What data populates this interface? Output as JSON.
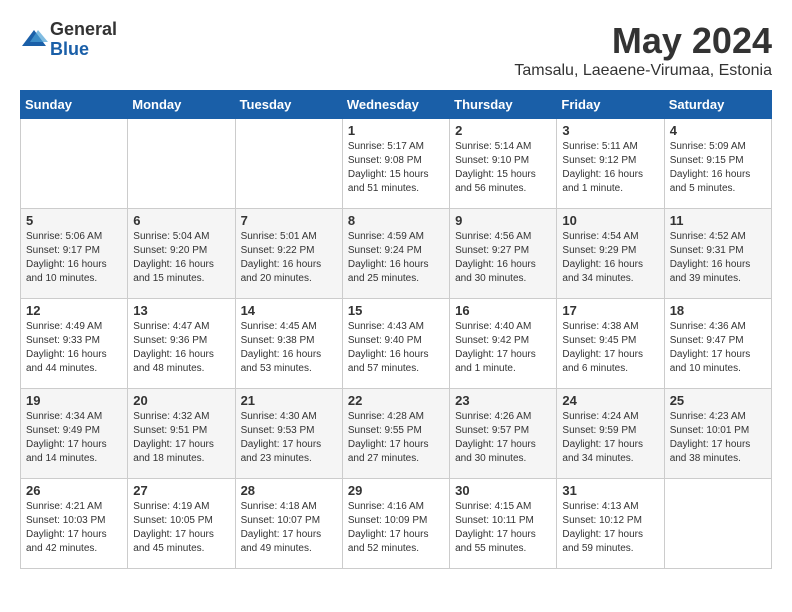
{
  "header": {
    "logo_general": "General",
    "logo_blue": "Blue",
    "month_year": "May 2024",
    "location": "Tamsalu, Laeaene-Virumaa, Estonia"
  },
  "weekdays": [
    "Sunday",
    "Monday",
    "Tuesday",
    "Wednesday",
    "Thursday",
    "Friday",
    "Saturday"
  ],
  "weeks": [
    [
      {
        "day": "",
        "info": ""
      },
      {
        "day": "",
        "info": ""
      },
      {
        "day": "",
        "info": ""
      },
      {
        "day": "1",
        "info": "Sunrise: 5:17 AM\nSunset: 9:08 PM\nDaylight: 15 hours and 51 minutes."
      },
      {
        "day": "2",
        "info": "Sunrise: 5:14 AM\nSunset: 9:10 PM\nDaylight: 15 hours and 56 minutes."
      },
      {
        "day": "3",
        "info": "Sunrise: 5:11 AM\nSunset: 9:12 PM\nDaylight: 16 hours and 1 minute."
      },
      {
        "day": "4",
        "info": "Sunrise: 5:09 AM\nSunset: 9:15 PM\nDaylight: 16 hours and 5 minutes."
      }
    ],
    [
      {
        "day": "5",
        "info": "Sunrise: 5:06 AM\nSunset: 9:17 PM\nDaylight: 16 hours and 10 minutes."
      },
      {
        "day": "6",
        "info": "Sunrise: 5:04 AM\nSunset: 9:20 PM\nDaylight: 16 hours and 15 minutes."
      },
      {
        "day": "7",
        "info": "Sunrise: 5:01 AM\nSunset: 9:22 PM\nDaylight: 16 hours and 20 minutes."
      },
      {
        "day": "8",
        "info": "Sunrise: 4:59 AM\nSunset: 9:24 PM\nDaylight: 16 hours and 25 minutes."
      },
      {
        "day": "9",
        "info": "Sunrise: 4:56 AM\nSunset: 9:27 PM\nDaylight: 16 hours and 30 minutes."
      },
      {
        "day": "10",
        "info": "Sunrise: 4:54 AM\nSunset: 9:29 PM\nDaylight: 16 hours and 34 minutes."
      },
      {
        "day": "11",
        "info": "Sunrise: 4:52 AM\nSunset: 9:31 PM\nDaylight: 16 hours and 39 minutes."
      }
    ],
    [
      {
        "day": "12",
        "info": "Sunrise: 4:49 AM\nSunset: 9:33 PM\nDaylight: 16 hours and 44 minutes."
      },
      {
        "day": "13",
        "info": "Sunrise: 4:47 AM\nSunset: 9:36 PM\nDaylight: 16 hours and 48 minutes."
      },
      {
        "day": "14",
        "info": "Sunrise: 4:45 AM\nSunset: 9:38 PM\nDaylight: 16 hours and 53 minutes."
      },
      {
        "day": "15",
        "info": "Sunrise: 4:43 AM\nSunset: 9:40 PM\nDaylight: 16 hours and 57 minutes."
      },
      {
        "day": "16",
        "info": "Sunrise: 4:40 AM\nSunset: 9:42 PM\nDaylight: 17 hours and 1 minute."
      },
      {
        "day": "17",
        "info": "Sunrise: 4:38 AM\nSunset: 9:45 PM\nDaylight: 17 hours and 6 minutes."
      },
      {
        "day": "18",
        "info": "Sunrise: 4:36 AM\nSunset: 9:47 PM\nDaylight: 17 hours and 10 minutes."
      }
    ],
    [
      {
        "day": "19",
        "info": "Sunrise: 4:34 AM\nSunset: 9:49 PM\nDaylight: 17 hours and 14 minutes."
      },
      {
        "day": "20",
        "info": "Sunrise: 4:32 AM\nSunset: 9:51 PM\nDaylight: 17 hours and 18 minutes."
      },
      {
        "day": "21",
        "info": "Sunrise: 4:30 AM\nSunset: 9:53 PM\nDaylight: 17 hours and 23 minutes."
      },
      {
        "day": "22",
        "info": "Sunrise: 4:28 AM\nSunset: 9:55 PM\nDaylight: 17 hours and 27 minutes."
      },
      {
        "day": "23",
        "info": "Sunrise: 4:26 AM\nSunset: 9:57 PM\nDaylight: 17 hours and 30 minutes."
      },
      {
        "day": "24",
        "info": "Sunrise: 4:24 AM\nSunset: 9:59 PM\nDaylight: 17 hours and 34 minutes."
      },
      {
        "day": "25",
        "info": "Sunrise: 4:23 AM\nSunset: 10:01 PM\nDaylight: 17 hours and 38 minutes."
      }
    ],
    [
      {
        "day": "26",
        "info": "Sunrise: 4:21 AM\nSunset: 10:03 PM\nDaylight: 17 hours and 42 minutes."
      },
      {
        "day": "27",
        "info": "Sunrise: 4:19 AM\nSunset: 10:05 PM\nDaylight: 17 hours and 45 minutes."
      },
      {
        "day": "28",
        "info": "Sunrise: 4:18 AM\nSunset: 10:07 PM\nDaylight: 17 hours and 49 minutes."
      },
      {
        "day": "29",
        "info": "Sunrise: 4:16 AM\nSunset: 10:09 PM\nDaylight: 17 hours and 52 minutes."
      },
      {
        "day": "30",
        "info": "Sunrise: 4:15 AM\nSunset: 10:11 PM\nDaylight: 17 hours and 55 minutes."
      },
      {
        "day": "31",
        "info": "Sunrise: 4:13 AM\nSunset: 10:12 PM\nDaylight: 17 hours and 59 minutes."
      },
      {
        "day": "",
        "info": ""
      }
    ]
  ]
}
